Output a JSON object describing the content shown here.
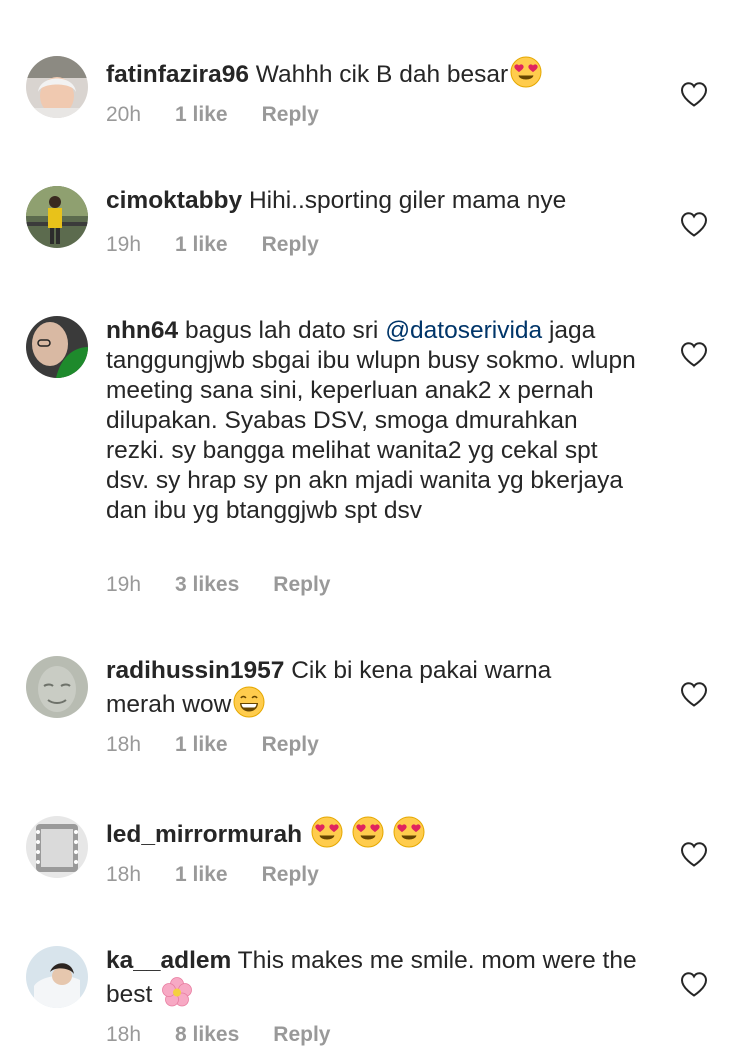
{
  "comments": [
    {
      "username": "fatinfazira96",
      "text": " Wahhh cik B dah besar",
      "time": "20h",
      "likes": "1 like",
      "reply": "Reply"
    },
    {
      "username": "cimoktabby",
      "text": " Hihi..sporting giler mama nye",
      "time": "19h",
      "likes": "1 like",
      "reply": "Reply"
    },
    {
      "username": "nhn64",
      "text_before": " bagus lah dato sri ",
      "mention": "@datoserivida",
      "text_after": " jaga tanggungjwb sbgai ibu wlupn busy sokmo. wlupn meeting sana sini, keperluan anak2 x pernah dilupakan. Syabas DSV, smoga dmurahkan rezki. sy bangga melihat wanita2 yg cekal spt dsv. sy hrap sy pn akn mjadi wanita yg bkerjaya dan ibu yg btanggjwb spt dsv",
      "time": "19h",
      "likes": "3 likes",
      "reply": "Reply"
    },
    {
      "username": "radihussin1957",
      "text": " Cik bi  kena pakai  warna merah wow",
      "time": "18h",
      "likes": "1 like",
      "reply": "Reply"
    },
    {
      "username": "led_mirrormurah",
      "text": " ",
      "time": "18h",
      "likes": "1 like",
      "reply": "Reply"
    },
    {
      "username": "ka__adlem",
      "text": " This makes me smile. mom were the best ",
      "time": "18h",
      "likes": "8 likes",
      "reply": "Reply"
    }
  ],
  "icons": {
    "heart": "heart-outline-icon",
    "heart_eyes": "heart-eyes-emoji",
    "grin": "grinning-emoji",
    "blossom": "cherry-blossom-emoji"
  },
  "colors": {
    "text": "#262626",
    "meta": "#999999",
    "mention": "#003569",
    "heart": "#262626"
  }
}
